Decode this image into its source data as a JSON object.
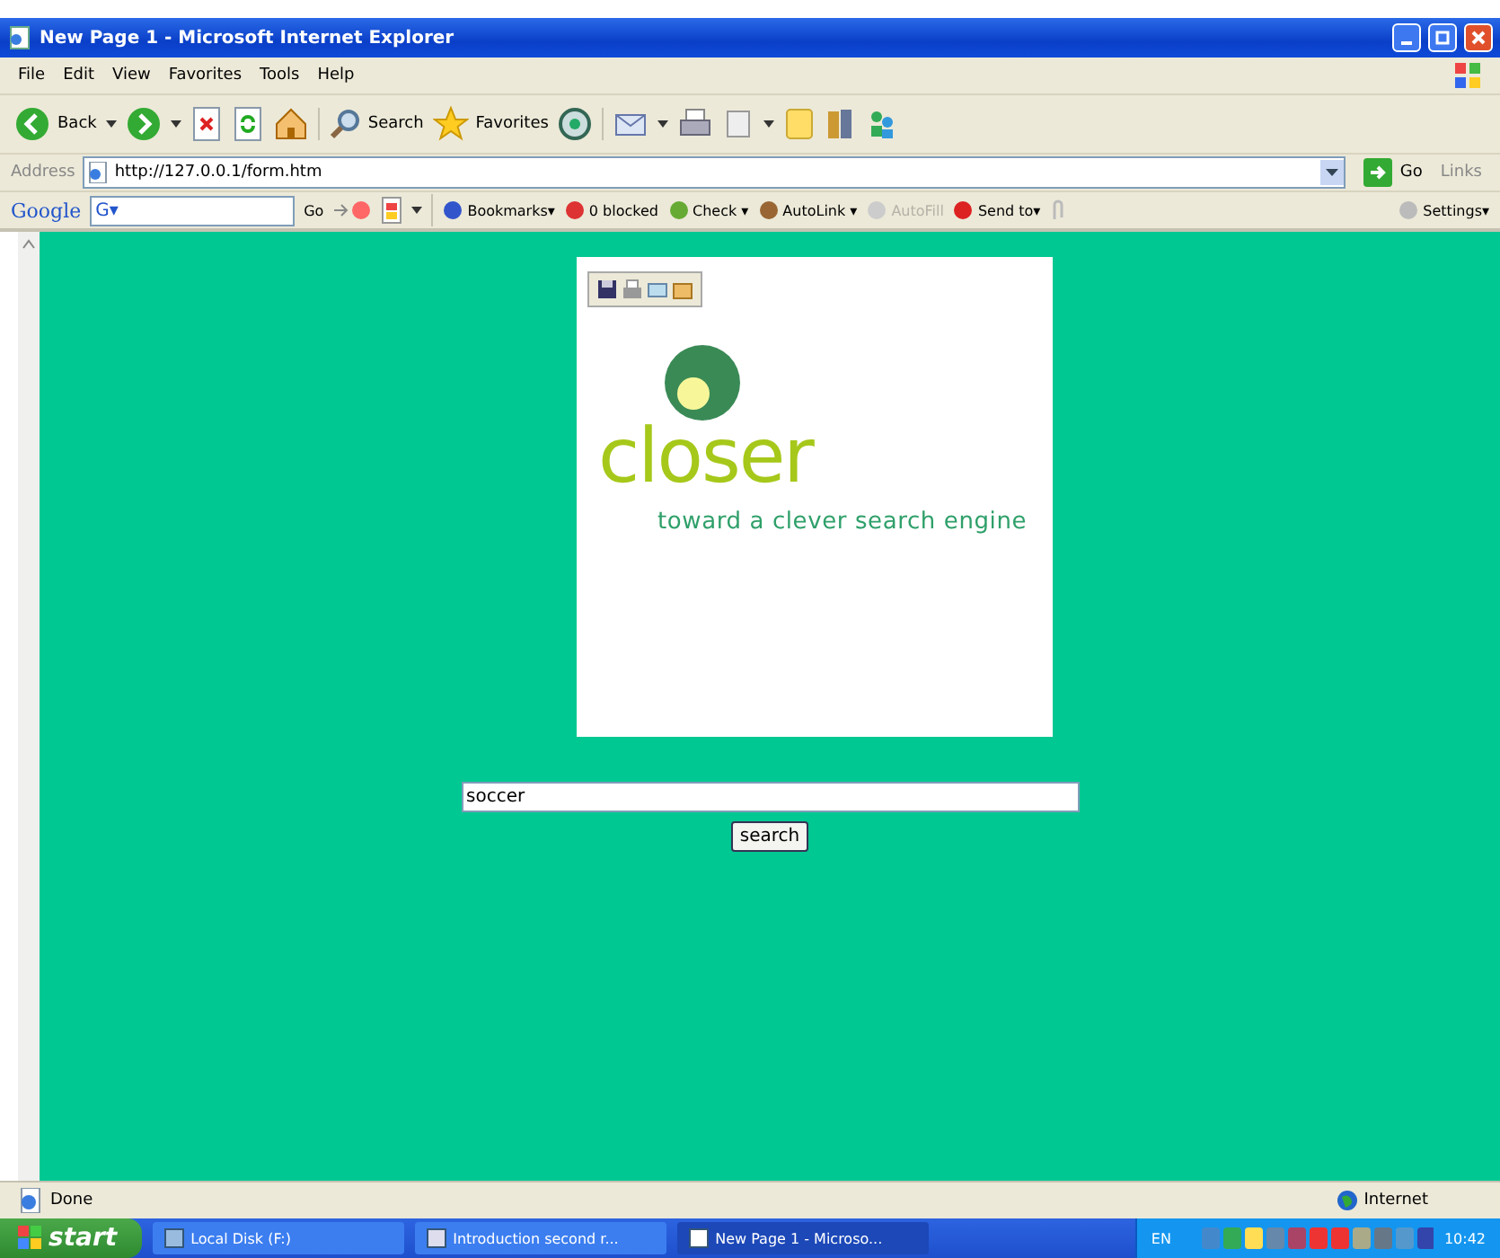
{
  "window": {
    "title": "New Page 1 - Microsoft Internet Explorer"
  },
  "menu": [
    "File",
    "Edit",
    "View",
    "Favorites",
    "Tools",
    "Help"
  ],
  "toolbar": {
    "back": "Back",
    "search": "Search",
    "favorites": "Favorites"
  },
  "address": {
    "label": "Address",
    "value": "http://127.0.0.1/form.htm",
    "go": "Go",
    "links": "Links"
  },
  "google_bar": {
    "logo": "Google",
    "field": "G▾",
    "go": "Go",
    "items": [
      {
        "label": "Bookmarks▾",
        "disabled": false
      },
      {
        "label": "0 blocked",
        "disabled": false
      },
      {
        "label": "Check ▾",
        "disabled": false
      },
      {
        "label": "AutoLink ▾",
        "disabled": false
      },
      {
        "label": "AutoFill",
        "disabled": true
      },
      {
        "label": "Send to▾",
        "disabled": false
      }
    ],
    "settings": "Settings▾"
  },
  "page": {
    "logo": "closer",
    "tagline": "toward a clever search engine",
    "search_value": "soccer",
    "button": "search"
  },
  "status_bar": {
    "text": "Done",
    "zone": "Internet"
  },
  "taskbar": {
    "start": "start",
    "tasks": [
      {
        "label": "Local Disk (F:)",
        "selected": false
      },
      {
        "label": "Introduction second r...",
        "selected": false
      },
      {
        "label": "New Page 1 - Microso...",
        "selected": true
      }
    ],
    "language": "EN",
    "clock": "10:42"
  }
}
